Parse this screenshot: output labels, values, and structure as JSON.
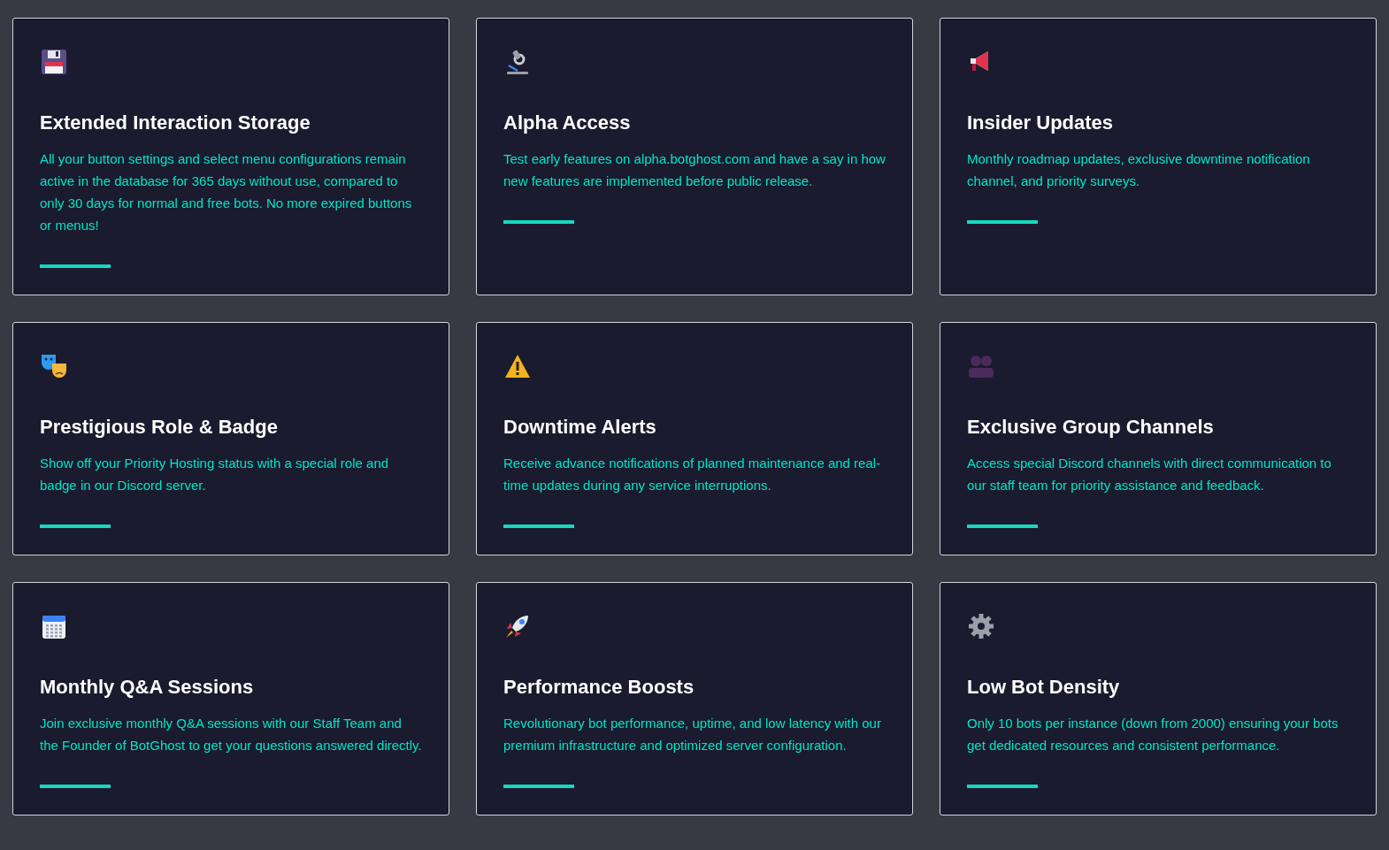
{
  "cards": [
    {
      "title": "Extended Interaction Storage",
      "description": "All your button settings and select menu configurations remain active in the database for 365 days without use, compared to only 30 days for normal and free bots. No more expired buttons or menus!"
    },
    {
      "title": "Alpha Access",
      "description": "Test early features on alpha.botghost.com and have a say in how new features are implemented before public release."
    },
    {
      "title": "Insider Updates",
      "description": "Monthly roadmap updates, exclusive downtime notification channel, and priority surveys."
    },
    {
      "title": "Prestigious Role & Badge",
      "description": "Show off your Priority Hosting status with a special role and badge in our Discord server."
    },
    {
      "title": "Downtime Alerts",
      "description": "Receive advance notifications of planned maintenance and real-time updates during any service interruptions."
    },
    {
      "title": "Exclusive Group Channels",
      "description": "Access special Discord channels with direct communication to our staff team for priority assistance and feedback."
    },
    {
      "title": "Monthly Q&A Sessions",
      "description": "Join exclusive monthly Q&A sessions with our Staff Team and the Founder of BotGhost to get your questions answered directly."
    },
    {
      "title": "Performance Boosts",
      "description": "Revolutionary bot performance, uptime, and low latency with our premium infrastructure and optimized server configuration."
    },
    {
      "title": "Low Bot Density",
      "description": "Only 10 bots per instance (down from 2000) ensuring your bots get dedicated resources and consistent performance."
    }
  ]
}
